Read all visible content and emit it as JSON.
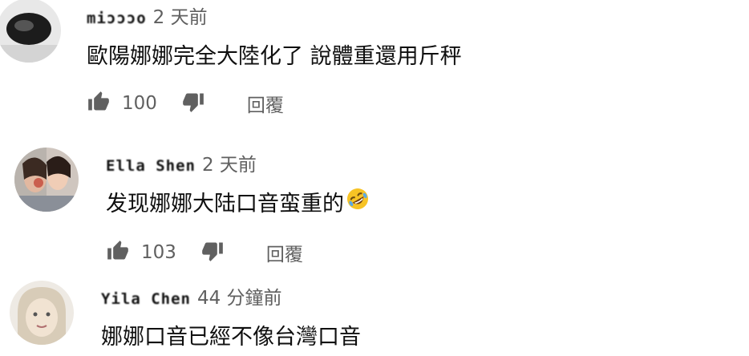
{
  "comments": [
    {
      "author": "miɔɔɔo",
      "time": "2 天前",
      "text": "歐陽娜娜完全大陸化了 說體重還用斤秤",
      "likes": "100",
      "reply": "回覆"
    },
    {
      "author": "Ella Shen",
      "time": "2 天前",
      "text": "发现娜娜大陆口音蛮重的",
      "emoji": "rolling-on-floor-laughing",
      "likes": "103",
      "reply": "回覆"
    },
    {
      "author": "Yila Chen",
      "time": "44 分鐘前",
      "text": "娜娜口音已經不像台灣口音"
    }
  ],
  "colors": {
    "text": "#0f0f0f",
    "secondary": "#606060",
    "icon": "#606060"
  },
  "icons": [
    "thumb-up-icon",
    "thumb-down-icon"
  ]
}
